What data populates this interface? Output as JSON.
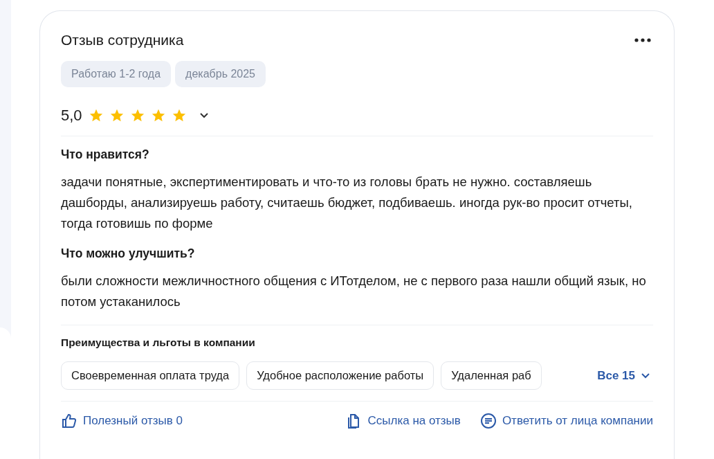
{
  "review": {
    "title": "Отзыв сотрудника",
    "tags": [
      "Работаю 1-2 года",
      "декабрь 2025"
    ],
    "rating": {
      "value": "5,0",
      "stars": 5,
      "expanded": false
    },
    "sections": [
      {
        "heading": "Что нравится?",
        "text": "задачи понятные, экспертиментировать и что-то из головы брать не нужно. составляешь дашборды, анализируешь работу, считаешь бюджет, подбиваешь. иногда рук-во просит отчеты, тогда готовишь по форме"
      },
      {
        "heading": "Что можно улучшить?",
        "text": "были сложности межличностного общения с ИТотделом, не с первого раза нашли общий язык, но потом устаканилось"
      }
    ],
    "benefits": {
      "heading": "Преимущества и льготы в компании",
      "items": [
        "Своевременная оплата труда",
        "Удобное расположение работы",
        "Удаленная раб"
      ],
      "more": "Все 15"
    },
    "actions": [
      {
        "kind": "like",
        "label": "Полезный отзыв 0"
      },
      {
        "kind": "link",
        "label": "Ссылка на отзыв"
      },
      {
        "kind": "reply",
        "label": "Ответить от лица компании"
      }
    ]
  }
}
